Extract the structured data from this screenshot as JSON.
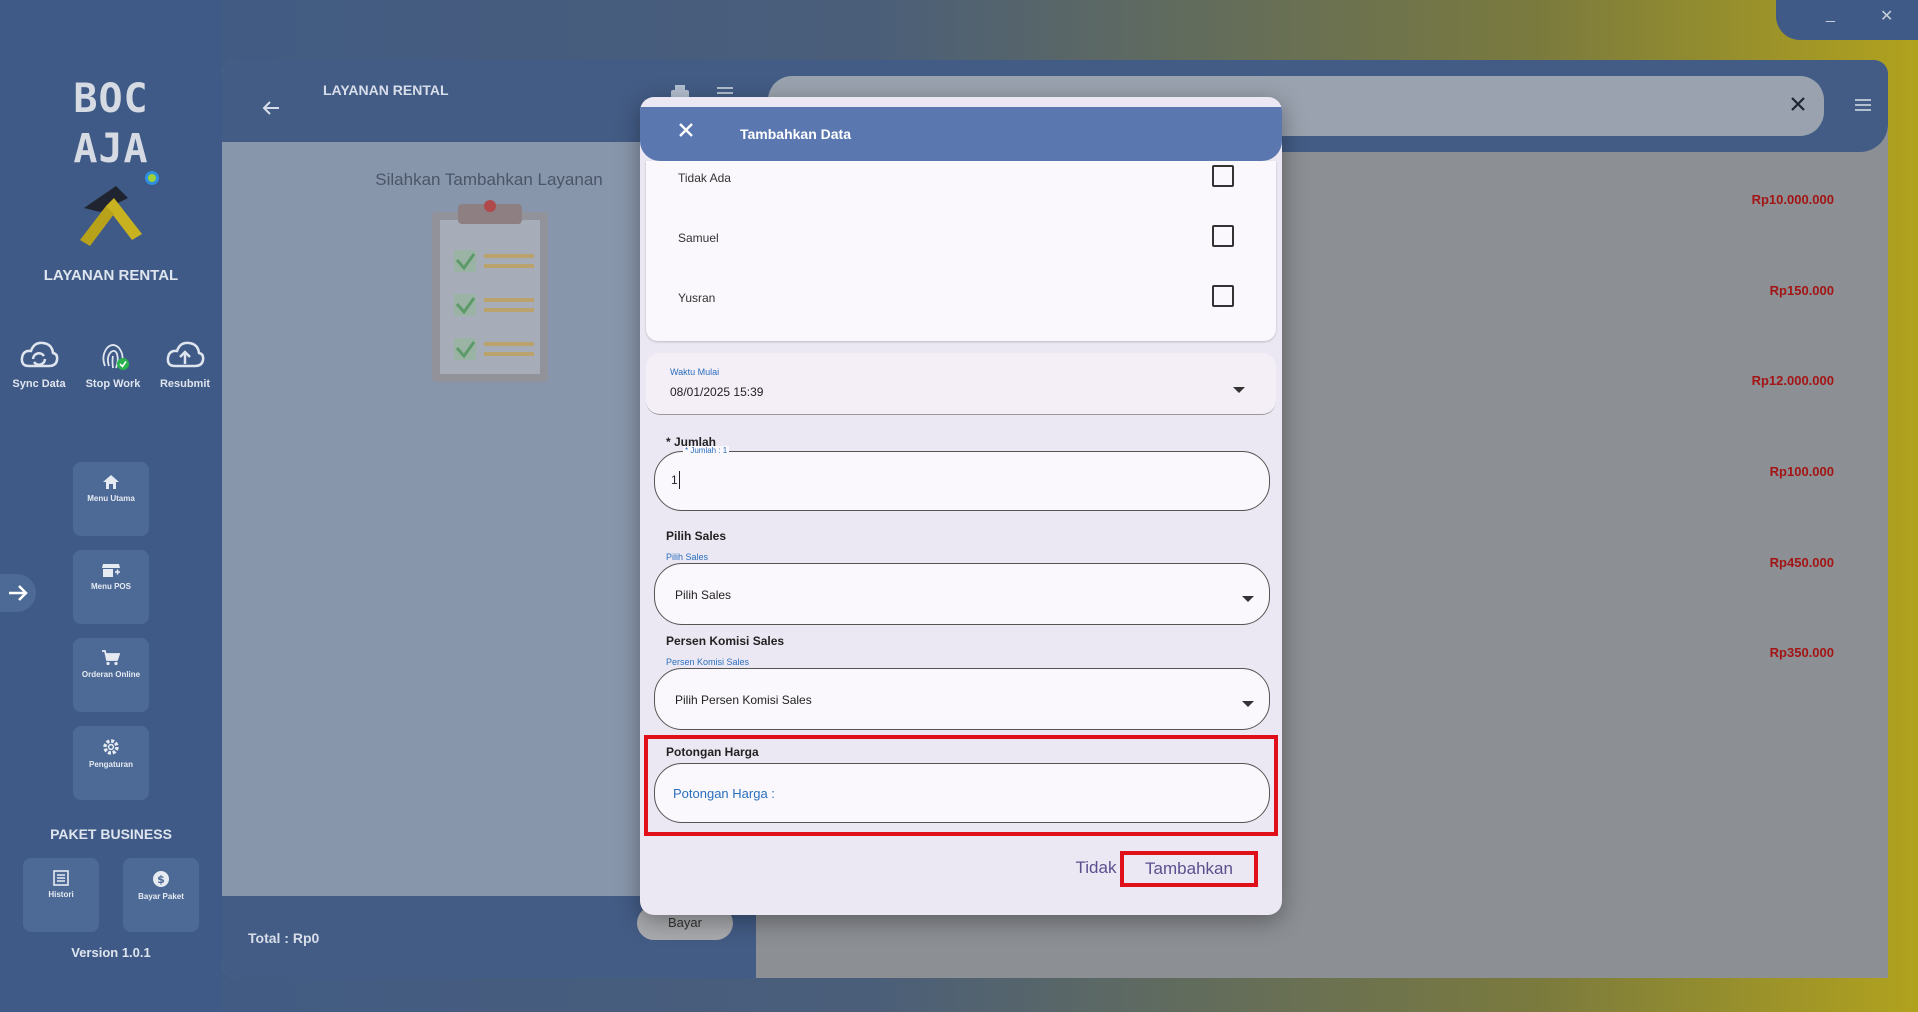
{
  "sidebar": {
    "logo_text": "BOC AJA",
    "app_title": "LAYANAN RENTAL",
    "top_actions": [
      {
        "label": "Sync Data",
        "icon": "cloud-sync-icon"
      },
      {
        "label": "Stop Work",
        "icon": "fingerprint-icon"
      },
      {
        "label": "Resubmit",
        "icon": "cloud-upload-icon"
      }
    ],
    "nav": [
      {
        "label": "Menu Utama",
        "icon": "home-icon"
      },
      {
        "label": "Menu POS",
        "icon": "store-icon"
      },
      {
        "label": "Orderan Online",
        "icon": "cart-icon"
      },
      {
        "label": "Pengaturan",
        "icon": "gear-icon"
      }
    ],
    "paket_title": "PAKET BUSINESS",
    "paket": [
      {
        "label": "Histori",
        "icon": "list-icon"
      },
      {
        "label": "Bayar Paket",
        "icon": "dollar-icon"
      }
    ],
    "version": "Version 1.0.1"
  },
  "left_panel": {
    "title": "LAYANAN RENTAL",
    "empty_message": "Silahkan Tambahkan Layanan",
    "total": "Total :  Rp0",
    "bayar_label": "Bayar"
  },
  "right_panel": {
    "prices": [
      "Rp10.000.000",
      "Rp150.000",
      "Rp12.000.000",
      "Rp100.000",
      "Rp450.000",
      "Rp350.000"
    ]
  },
  "window": {
    "minimize": "_",
    "close": "✕"
  },
  "dialog": {
    "title": "Tambahkan Data",
    "staff": [
      {
        "name": "Tidak Ada",
        "checked": false
      },
      {
        "name": "Samuel",
        "checked": false
      },
      {
        "name": "Yusran",
        "checked": false
      }
    ],
    "waktu_label": "Waktu Mulai",
    "waktu_value": "08/01/2025 15:39",
    "jumlah_label": "* Jumlah",
    "jumlah_float": "* Jumlah : 1",
    "jumlah_value": "1",
    "sales_label": "Pilih Sales",
    "sales_float": "Pilih Sales",
    "sales_value": "Pilih Sales",
    "komisi_label": "Persen Komisi Sales",
    "komisi_float": "Persen Komisi Sales",
    "komisi_value": "Pilih Persen Komisi Sales",
    "potongan_label": "Potongan Harga",
    "potongan_placeholder": "Potongan Harga :",
    "btn_cancel": "Tidak",
    "btn_submit": "Tambahkan"
  },
  "colors": {
    "accent": "#5b77b0",
    "highlight": "#e0101b",
    "price": "#a31515"
  }
}
